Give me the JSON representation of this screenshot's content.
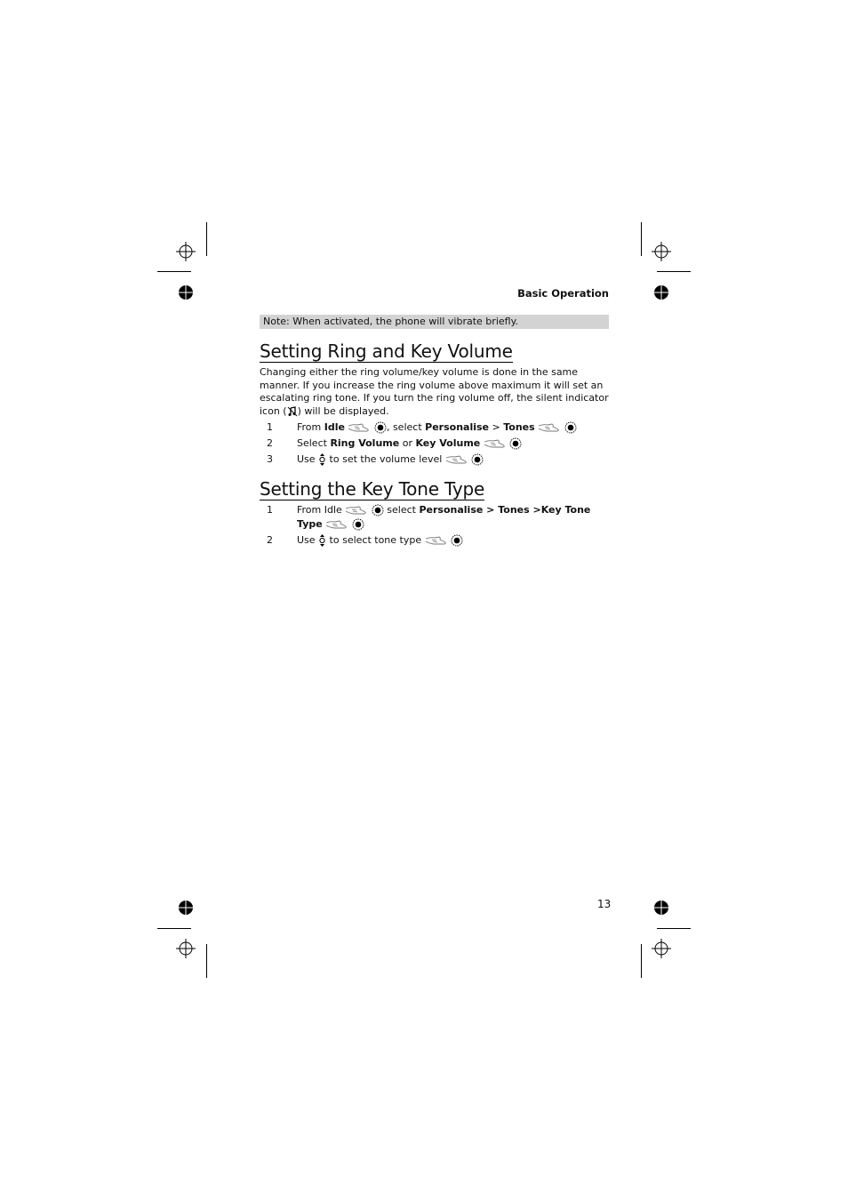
{
  "header": {
    "section": "Basic Operation"
  },
  "note": "Note: When activated, the phone will vibrate briefly.",
  "section1": {
    "title": "Setting Ring and Key Volume",
    "paragraph_parts": [
      "Changing either the ring volume/key volume is done in the same manner. If you increase the ring volume above maximum it will set an escalating ring tone. If you turn the ring volume off, the silent indicator icon (",
      ") will be displayed."
    ],
    "steps": [
      {
        "num": "1",
        "parts": [
          "From ",
          "Idle",
          ", select ",
          "Personalise",
          " > ",
          "Tones"
        ]
      },
      {
        "num": "2",
        "parts": [
          "Select ",
          "Ring Volume",
          " or ",
          "Key Volume"
        ]
      },
      {
        "num": "3",
        "parts": [
          "Use ",
          "to set the volume level"
        ]
      }
    ]
  },
  "section2": {
    "title": "Setting the Key Tone Type",
    "steps": [
      {
        "num": "1",
        "parts": [
          "From Idle ",
          "select ",
          "Personalise > Tones >Key Tone",
          "Type"
        ]
      },
      {
        "num": "2",
        "parts": [
          "Use ",
          "to select tone type"
        ]
      }
    ]
  },
  "icons": {
    "hand": "pointing-hand-icon",
    "select": "select-key-icon",
    "nav": "navigation-updown-icon",
    "silent": "silent-indicator-icon"
  },
  "footer": {
    "page_number": "13"
  }
}
